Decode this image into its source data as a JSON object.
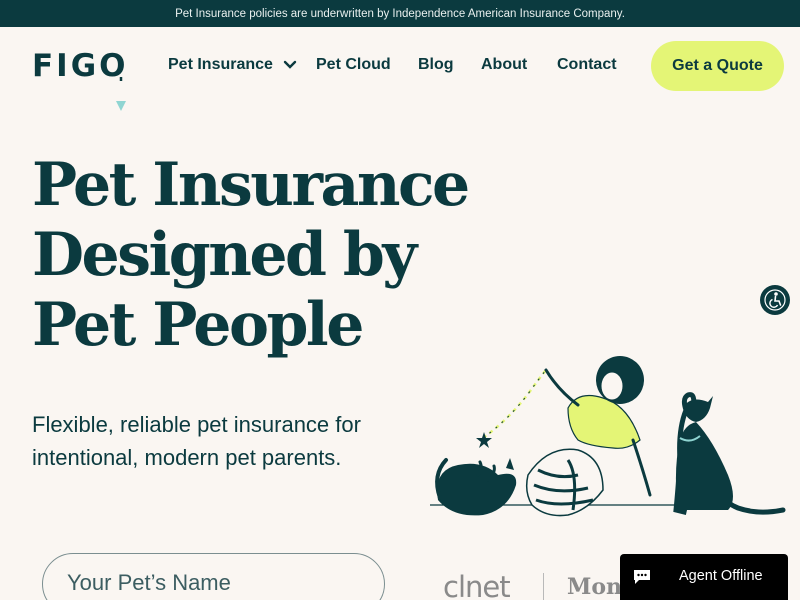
{
  "announcement": "Pet Insurance policies are underwritten by Independence American Insurance Company.",
  "logo": {
    "text": "FIGO"
  },
  "nav": {
    "items": [
      {
        "label": "Pet Insurance"
      },
      {
        "label": "Pet Cloud"
      },
      {
        "label": "Blog"
      },
      {
        "label": "About"
      },
      {
        "label": "Contact"
      }
    ],
    "cta": "Get a Quote"
  },
  "hero": {
    "headline": [
      "Pet Insurance",
      "Designed by",
      "Pet People"
    ],
    "subhead": "Flexible, reliable pet insurance for intentional, modern pet parents.",
    "pet_name_placeholder": "Your Pet’s Name"
  },
  "press": [
    "clnet",
    "Mon"
  ],
  "chat": {
    "status": "Agent Offline"
  },
  "colors": {
    "primary": "#0b3a3f",
    "accent": "#e4f576",
    "background": "#faf6f2"
  },
  "icons": [
    "chevron-down-icon",
    "accessibility-icon",
    "chat-bubble-icon",
    "figo-tag-icon"
  ]
}
